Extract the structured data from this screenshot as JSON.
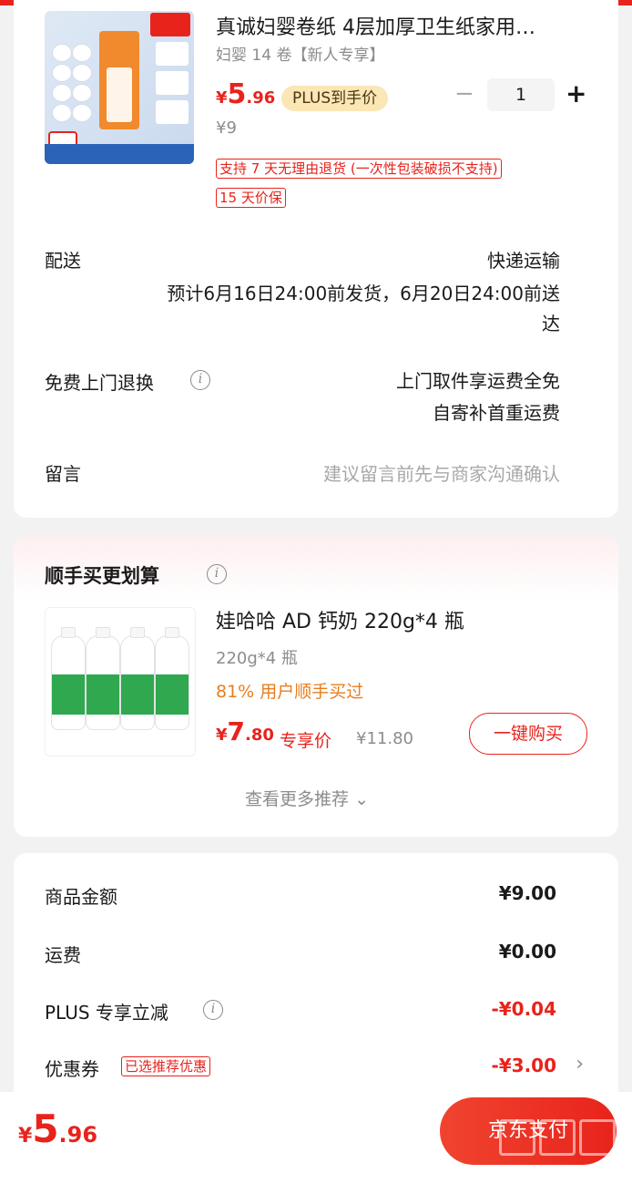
{
  "product": {
    "title": "真诚妇婴卷纸 4层加厚卫生纸家用…",
    "spec": "妇婴 14 卷【新人专享】",
    "price_symbol": "¥",
    "price_int": "5",
    "price_dec": ".96",
    "plus_label": "PLUS到手价",
    "original_price": "¥9",
    "quantity": "1",
    "minus": "−",
    "plus": "+",
    "tags": [
      "支持 7 天无理由退货 (一次性包装破损不支持)",
      "15 天价保"
    ]
  },
  "delivery": {
    "label": "配送",
    "method": "快递运输",
    "line1": "预计6月16日24:00前发货，6月20日24:00前送",
    "line2": "达"
  },
  "return": {
    "label": "免费上门退换",
    "info_icon": "i",
    "line1": "上门取件享运费全免",
    "line2": "自寄补首重运费"
  },
  "message": {
    "label": "留言",
    "placeholder": "建议留言前先与商家沟通确认"
  },
  "recommend": {
    "title": "顺手买更划算",
    "info_icon": "i",
    "item_title": "娃哈哈 AD 钙奶 220g*4 瓶",
    "item_spec": "220g*4 瓶",
    "item_stat": "81% 用户顺手买过",
    "price_symbol": "¥",
    "price_int": "7",
    "price_dec": ".80",
    "price_label": "专享价",
    "original_price": "¥11.80",
    "buy_button": "一键购买",
    "more": "查看更多推荐",
    "more_icon": "⌄"
  },
  "summary": {
    "rows": [
      {
        "label": "商品金额",
        "value": "¥9.00"
      },
      {
        "label": "运费",
        "value": "¥0.00"
      },
      {
        "label": "PLUS 专享立减",
        "value": "-¥0.04"
      },
      {
        "label": "优惠券",
        "tag": "已选推荐优惠",
        "value": "-¥3.00",
        "chevron": "›"
      }
    ]
  },
  "footer": {
    "price_symbol": "¥",
    "price_int": "5",
    "price_dec": ".96",
    "submit": "京东支付"
  },
  "colors": {
    "accent": "#e8231c",
    "price_orange": "#e87e1e",
    "plus_badge": "#fbe6b5"
  }
}
